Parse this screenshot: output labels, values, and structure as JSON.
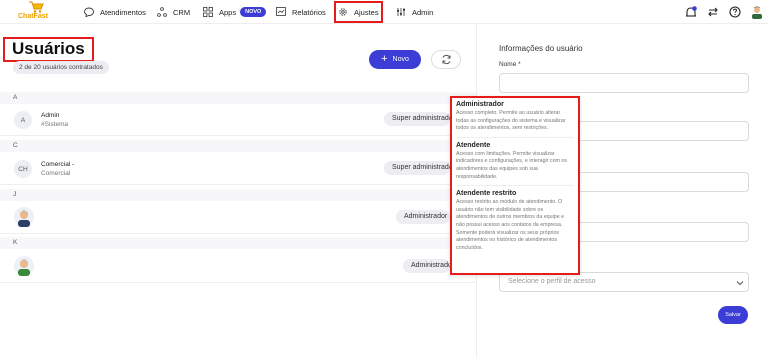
{
  "app": {
    "brand": "ChatFast"
  },
  "nav": {
    "atendimentos": "Atendimentos",
    "crm": "CRM",
    "apps": "Apps",
    "apps_badge": "NOVO",
    "relatorios": "Relatórios",
    "ajustes": "Ajustes",
    "admin": "Admin"
  },
  "page": {
    "title": "Usuários",
    "count": "2 de 20 usuários contratados",
    "new_button": "Novo"
  },
  "sections": [
    {
      "letter": "A"
    },
    {
      "letter": "C"
    },
    {
      "letter": "J"
    },
    {
      "letter": "K"
    }
  ],
  "users": [
    {
      "initials": "A",
      "name": "Admin",
      "sub": "#Sistema",
      "role": "Super administrador"
    },
    {
      "initials": "CH",
      "name": "Comercial -",
      "sub": "Comercial",
      "role": "Super administrador"
    },
    {
      "initials": "",
      "name": "",
      "sub": "",
      "role": "Administrador"
    },
    {
      "initials": "",
      "name": "",
      "sub": "",
      "role": "Administrador"
    }
  ],
  "form": {
    "title": "Informações do usuário",
    "name_label": "Nome *",
    "profile_placeholder": "Selecione o perfil de acesso",
    "save": "Salvar"
  },
  "tooltip": {
    "items": [
      {
        "title": "Administrador",
        "desc": "Acesso completo. Permite ao usuário alterar todas as configurações do sistema e visualizar todos os atendimentos, sem restrições."
      },
      {
        "title": "Atendente",
        "desc": "Acesso com limitações. Permite visualizar indicadores e configurações, e interagir com os atendimentos das equipes sob sua responsabilidade."
      },
      {
        "title": "Atendente restrito",
        "desc": "Acesso restrito ao módulo de atendimento. O usuário não tem visibilidade sobre os atendimentos de outros membros da equipe e não possui acesso aos contatos da empresa. Somente poderá visualizar os seus próprios atendimentos no histórico de atendimentos concluídos."
      }
    ]
  },
  "colors": {
    "accent": "#3c3cd6",
    "highlight": "#e51c1c",
    "brand": "#f0a000",
    "notification": "#3c3cd6"
  },
  "icons": {
    "atendimentos": "chat-bubble-icon",
    "crm": "crm-nodes-icon",
    "apps": "grid-icon",
    "relatorios": "report-icon",
    "ajustes": "gear-icon",
    "admin": "admin-sliders-icon"
  }
}
